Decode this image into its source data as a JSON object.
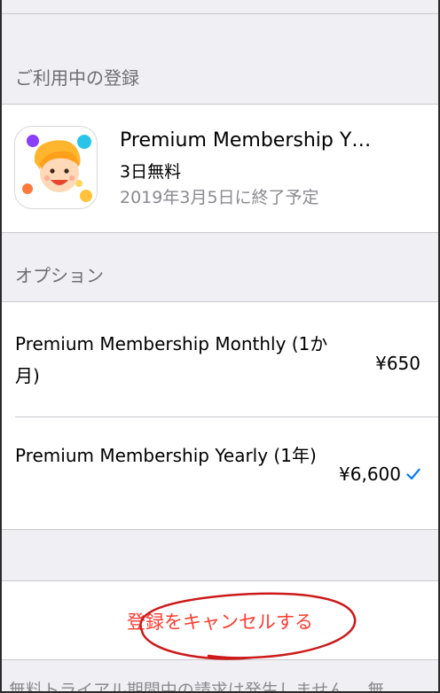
{
  "current_section": {
    "header": "ご利用中の登録",
    "subscription": {
      "title": "Premium Membership Y…",
      "trial": "3日無料",
      "expiry": "2019年3月5日に終了予定",
      "icon": "app-character-icon"
    }
  },
  "options_section": {
    "header": "オプション",
    "options": [
      {
        "name": "Premium Membership Monthly (1か月)",
        "price": "¥650",
        "selected": false
      },
      {
        "name": "Premium Membership Yearly (1年)",
        "price": "¥6,600",
        "selected": true
      }
    ]
  },
  "cancel_button": {
    "label": "登録をキャンセルする"
  },
  "footer": {
    "text": "無料トライアル期間中の請求は発生しません。 無"
  },
  "colors": {
    "background": "#efeff4",
    "destructive": "#ff3b30",
    "accent": "#007aff",
    "annotation": "#cc1a1a"
  }
}
